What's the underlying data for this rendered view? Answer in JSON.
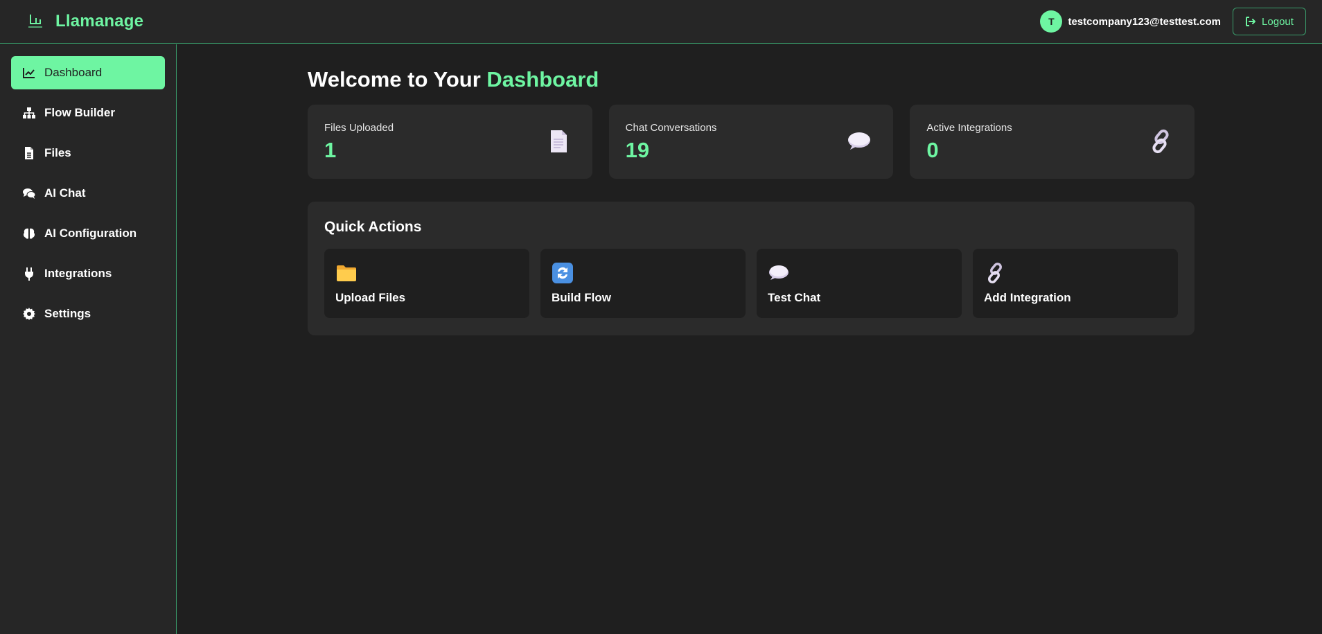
{
  "app": {
    "name": "Llamanage",
    "accent": "#6ef5a2"
  },
  "header": {
    "avatar_initial": "T",
    "user_email": "testcompany123@testtest.com",
    "logout_label": "Logout"
  },
  "sidebar": {
    "items": [
      {
        "label": "Dashboard",
        "icon": "chart-line-icon",
        "active": true
      },
      {
        "label": "Flow Builder",
        "icon": "sitemap-icon"
      },
      {
        "label": "Files",
        "icon": "file-icon"
      },
      {
        "label": "AI Chat",
        "icon": "comments-icon"
      },
      {
        "label": "AI Configuration",
        "icon": "brain-icon"
      },
      {
        "label": "Integrations",
        "icon": "plug-icon"
      },
      {
        "label": "Settings",
        "icon": "gear-icon"
      }
    ]
  },
  "main": {
    "welcome_prefix": "Welcome to Your",
    "welcome_accent": "Dashboard",
    "stats": [
      {
        "label": "Files Uploaded",
        "value": "1",
        "icon": "document-icon"
      },
      {
        "label": "Chat Conversations",
        "value": "19",
        "icon": "speech-bubble-icon"
      },
      {
        "label": "Active Integrations",
        "value": "0",
        "icon": "link-icon"
      }
    ],
    "quick_actions": {
      "title": "Quick Actions",
      "items": [
        {
          "label": "Upload Files",
          "icon": "folder-icon"
        },
        {
          "label": "Build Flow",
          "icon": "refresh-icon"
        },
        {
          "label": "Test Chat",
          "icon": "speech-bubble-icon"
        },
        {
          "label": "Add Integration",
          "icon": "link-icon"
        }
      ]
    }
  }
}
